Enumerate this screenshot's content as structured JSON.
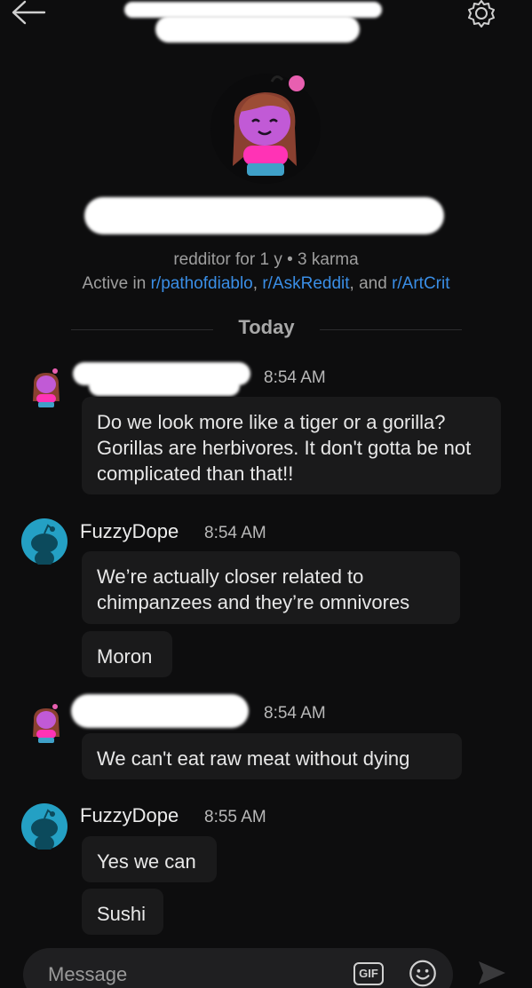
{
  "header": {
    "back_icon": "arrow-left-icon",
    "settings_icon": "gear-icon"
  },
  "profile": {
    "stats": "redditor for 1 y • 3 karma",
    "active_prefix": "Active in ",
    "communities": [
      "r/pathofdiablo",
      "r/AskReddit",
      "r/ArtCrit"
    ],
    "separator_1": ", ",
    "separator_2": ", and "
  },
  "date_divider": "Today",
  "messages": [
    {
      "sender_time": "8:54 AM",
      "texts": [
        "Do we look more like a tiger or a gorilla? Gorillas are herbivores. It don't gotta be not complicated than that!!"
      ]
    },
    {
      "sender": "FuzzyDope",
      "sender_time": "8:54 AM",
      "texts": [
        "We’re actually closer related to chimpanzees and they’re omnivores",
        "Moron"
      ]
    },
    {
      "sender_time": "8:54 AM",
      "texts": [
        "We can't eat raw meat without dying"
      ]
    },
    {
      "sender": "FuzzyDope",
      "sender_time": "8:55 AM",
      "texts": [
        "Yes we can",
        "Sushi"
      ]
    }
  ],
  "composer": {
    "placeholder": "Message",
    "gif_label": "GIF",
    "emoji_icon": "emoji-icon",
    "send_icon": "send-icon"
  },
  "colors": {
    "background": "#0d0d0e",
    "bubble": "#1a1a1b",
    "link": "#3a8ee6",
    "snoo_bg": "#24a0c4"
  }
}
